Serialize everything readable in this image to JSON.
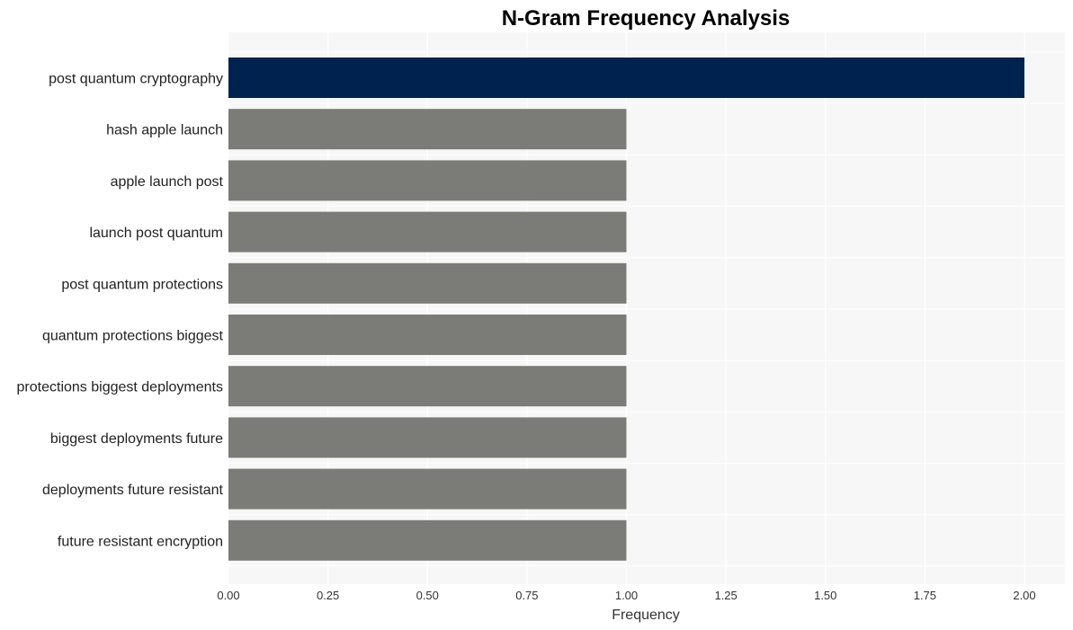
{
  "chart_data": {
    "type": "bar",
    "orientation": "horizontal",
    "title": "N-Gram Frequency Analysis",
    "xlabel": "Frequency",
    "ylabel": "",
    "categories": [
      "post quantum cryptography",
      "hash apple launch",
      "apple launch post",
      "launch post quantum",
      "post quantum protections",
      "quantum protections biggest",
      "protections biggest deployments",
      "biggest deployments future",
      "deployments future resistant",
      "future resistant encryption"
    ],
    "values": [
      2,
      1,
      1,
      1,
      1,
      1,
      1,
      1,
      1,
      1
    ],
    "bar_colors": [
      "#00224e",
      "#7b7b78",
      "#7b7b78",
      "#7b7b78",
      "#7b7b78",
      "#7b7b78",
      "#7b7b78",
      "#7b7b78",
      "#7b7b78",
      "#7b7b78"
    ],
    "xlim": [
      0,
      2.1
    ],
    "xticks": [
      "0.00",
      "0.25",
      "0.50",
      "0.75",
      "1.00",
      "1.25",
      "1.50",
      "1.75",
      "2.00"
    ],
    "xtick_values": [
      0,
      0.25,
      0.5,
      0.75,
      1.0,
      1.25,
      1.5,
      1.75,
      2.0
    ],
    "grid": true,
    "legend": "none",
    "plot_background": "#f7f7f7"
  }
}
